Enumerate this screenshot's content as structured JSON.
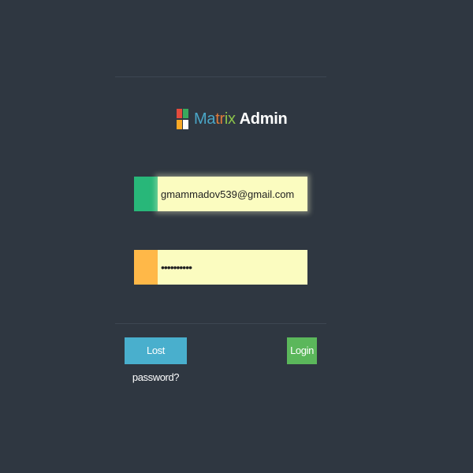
{
  "header": {
    "logo": {
      "name_part_1": "Ma",
      "name_part_2": "tr",
      "name_part_3": "ix",
      "name_part_4": "Admin",
      "mark_colors": [
        "#e44b3c",
        "#3aa95d",
        "#f9a825",
        "#ffffff"
      ],
      "text_colors": [
        "#4aa6c7",
        "#e07b39",
        "#8bc34a"
      ]
    }
  },
  "login_form": {
    "email": {
      "value": "gmammadov539@gmail.com",
      "addon_color": "#28b779",
      "addon_icon": "user-icon"
    },
    "password": {
      "value": "••••••••••",
      "addon_color": "#ffb848",
      "addon_icon": "lock-icon"
    },
    "lost_password_label": "Lost password?",
    "login_label": "Login"
  },
  "colors": {
    "background": "#2f3741",
    "input_background": "#fbfcc0",
    "lost_button": "#49afcd",
    "login_button": "#5bb75b"
  }
}
